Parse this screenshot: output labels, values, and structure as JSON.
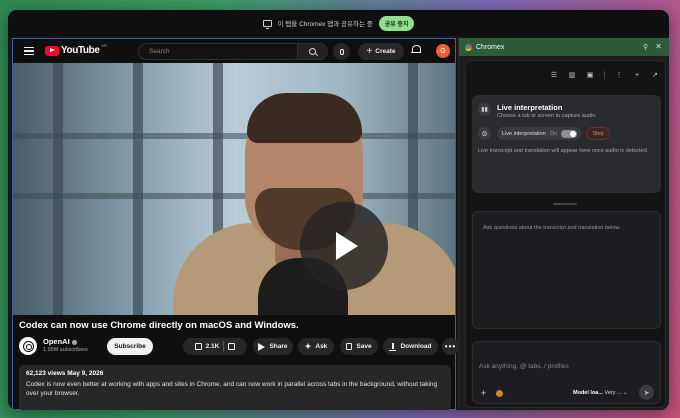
{
  "sharebar": {
    "message": "이 탭을 Chromex 앱과 공유하는 중",
    "stop_label": "공유 중지"
  },
  "youtube": {
    "logo_text": "YouTube",
    "logo_region": "KR",
    "search_placeholder": "Search",
    "create_label": "Create",
    "avatar_letter": "G",
    "video_title": "Codex can now use Chrome directly on macOS and Windows.",
    "channel_name": "OpenAI",
    "channel_subs": "1.95M subscribers",
    "subscribe_label": "Subscribe",
    "likes": "2.1K",
    "share_label": "Share",
    "ask_label": "Ask",
    "save_label": "Save",
    "download_label": "Download",
    "description": {
      "meta": "62,123 views  May 9, 2026",
      "text": "Codex is now even better at working with apps and sites in Chrome, and can now work in parallel across tabs in the background, without taking over your browser."
    }
  },
  "panel": {
    "title": "Chromex",
    "live": {
      "title": "Live interpretation",
      "subtitle": "Choose a tab or screen to capture audio.",
      "toggle_label": "Live interpretation",
      "toggle_state": "On",
      "stop_label": "Stop",
      "note": "Live transcript and translation will appear here once audio is detected."
    },
    "qa_hint": "Ask questions about the transcript and translation below.",
    "chat": {
      "placeholder": "Ask anything, @ tabs, / profiles",
      "model_label": "Model loa...",
      "effort_label": "Very ..."
    }
  },
  "colors": {
    "youtube_red": "#ff0033",
    "panel_header": "#2d5a3a",
    "share_stop": "#8ee08e",
    "avatar": "#e8613a"
  }
}
